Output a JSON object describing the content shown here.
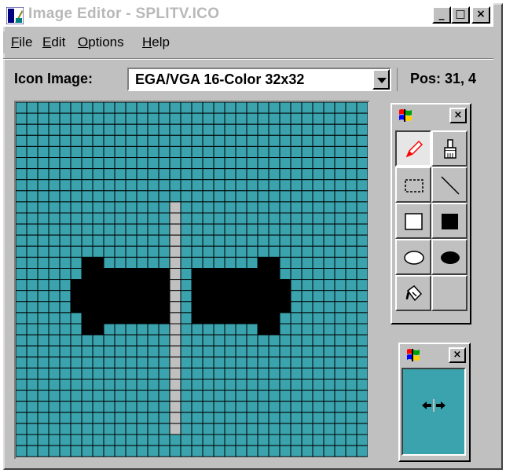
{
  "window": {
    "title": "Image Editor - SPLITV.ICO",
    "controls": {
      "minimize": "_",
      "maximize": "□",
      "close": "×"
    }
  },
  "menu": {
    "items": [
      {
        "label": "File",
        "mnemonic": "F",
        "rest": "ile"
      },
      {
        "label": "Edit",
        "mnemonic": "E",
        "rest": "dit"
      },
      {
        "label": "Options",
        "mnemonic": "O",
        "rest": "ptions"
      },
      {
        "label": "Help",
        "mnemonic": "H",
        "rest": "elp"
      }
    ]
  },
  "toolbar": {
    "icon_image_label": "Icon Image:",
    "icon_image_value": "EGA/VGA 16-Color 32x32",
    "position_readout": "Pos: 31, 4"
  },
  "canvas": {
    "grid_size": 32,
    "background_color": "#3aa3ad",
    "divider_color": "#c0c0c0",
    "arrow_color": "#000000",
    "image_content": "vertical gray split bar with black arrows pointing left and right"
  },
  "palette": {
    "close_label": "×",
    "tools": [
      {
        "name": "pencil-icon",
        "active": true
      },
      {
        "name": "brush-icon"
      },
      {
        "name": "selection-rectangle-icon"
      },
      {
        "name": "line-icon"
      },
      {
        "name": "hollow-rectangle-icon"
      },
      {
        "name": "filled-rectangle-icon"
      },
      {
        "name": "hollow-ellipse-icon"
      },
      {
        "name": "filled-ellipse-icon"
      },
      {
        "name": "paint-bucket-icon"
      },
      {
        "name": "empty-tool-slot"
      }
    ]
  },
  "preview": {
    "close_label": "×",
    "background_color": "#3aa3ad"
  }
}
